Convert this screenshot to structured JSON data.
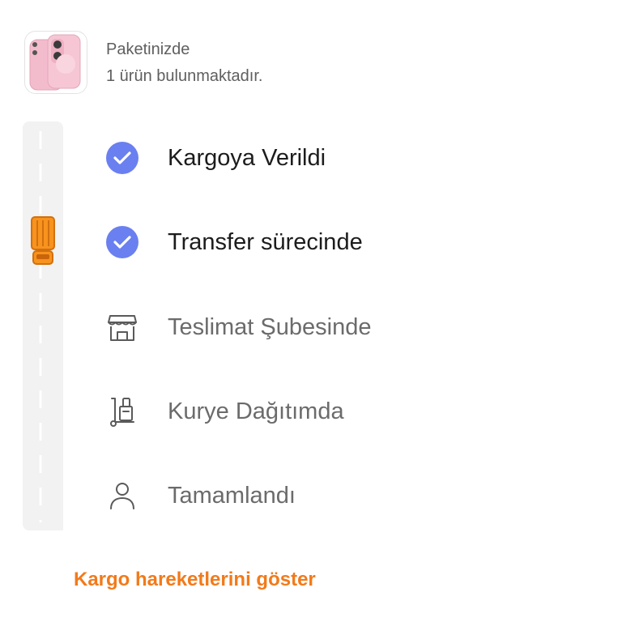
{
  "package": {
    "line1": "Paketinizde",
    "line2": "1 ürün bulunmaktadır.",
    "thumbnail_icon": "pink-phone-icon"
  },
  "tracker": {
    "road_color": "#f2f2f2",
    "truck_color": "#f27a1a",
    "steps": [
      {
        "label": "Kargoya Verildi",
        "status": "done",
        "icon": "check-circle-icon"
      },
      {
        "label": "Transfer sürecinde",
        "status": "done",
        "icon": "check-circle-icon"
      },
      {
        "label": "Teslimat Şubesinde",
        "status": "pending",
        "icon": "store-icon"
      },
      {
        "label": "Kurye Dağıtımda",
        "status": "pending",
        "icon": "courier-trolley-icon"
      },
      {
        "label": "Tamamlandı",
        "status": "pending",
        "icon": "person-icon"
      }
    ]
  },
  "actions": {
    "show_movements": "Kargo hareketlerini göster"
  },
  "colors": {
    "check": "#6a80f0",
    "accent": "#f27a1a"
  }
}
